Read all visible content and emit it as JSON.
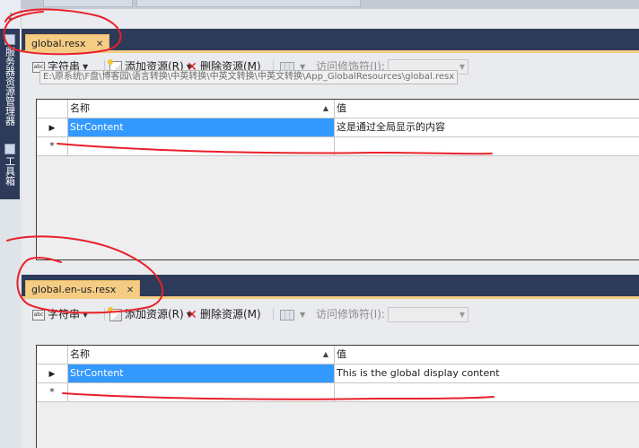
{
  "sidebar": {
    "vertical_tabs": [
      {
        "label": "服务器资源管理器",
        "icon": "server-explorer-icon"
      },
      {
        "label": "工具箱",
        "icon": "toolbox-icon"
      }
    ],
    "pin_glyph": "⇣"
  },
  "panels": [
    {
      "tab": {
        "label": "global.resx",
        "close_glyph": "✕"
      },
      "toolbar": {
        "string_label": "字符串",
        "add_label": "添加资源(R)",
        "delete_label": "删除资源(M)",
        "access_label": "访问修饰符(I):",
        "access_value": ""
      },
      "tooltip": "E:\\原系统\\F盘\\博客园\\语言转换\\中英转换\\中英文转换\\中英文转换\\App_GlobalResources\\global.resx",
      "grid": {
        "columns": [
          "名称",
          "值"
        ],
        "rows": [
          {
            "name": "StrContent",
            "value": "这是通过全局显示的内容"
          }
        ],
        "new_row_glyph": "*",
        "row_pointer_glyph": "▶",
        "sort_glyph": "▲"
      }
    },
    {
      "tab": {
        "label": "global.en-us.resx",
        "close_glyph": "✕"
      },
      "toolbar": {
        "string_label": "字符串",
        "add_label": "添加资源(R)",
        "delete_label": "删除资源(M)",
        "access_label": "访问修饰符(I):",
        "access_value": ""
      },
      "grid": {
        "columns": [
          "名称",
          "值"
        ],
        "rows": [
          {
            "name": "StrContent",
            "value": "This is the global display content"
          }
        ],
        "new_row_glyph": "*",
        "row_pointer_glyph": "▶",
        "sort_glyph": "▲"
      }
    }
  ],
  "colors": {
    "tab_well": "#2d3a5a",
    "active_tab": "#f5cc84",
    "selection": "#3399ff",
    "annotation": "#e8202a"
  }
}
